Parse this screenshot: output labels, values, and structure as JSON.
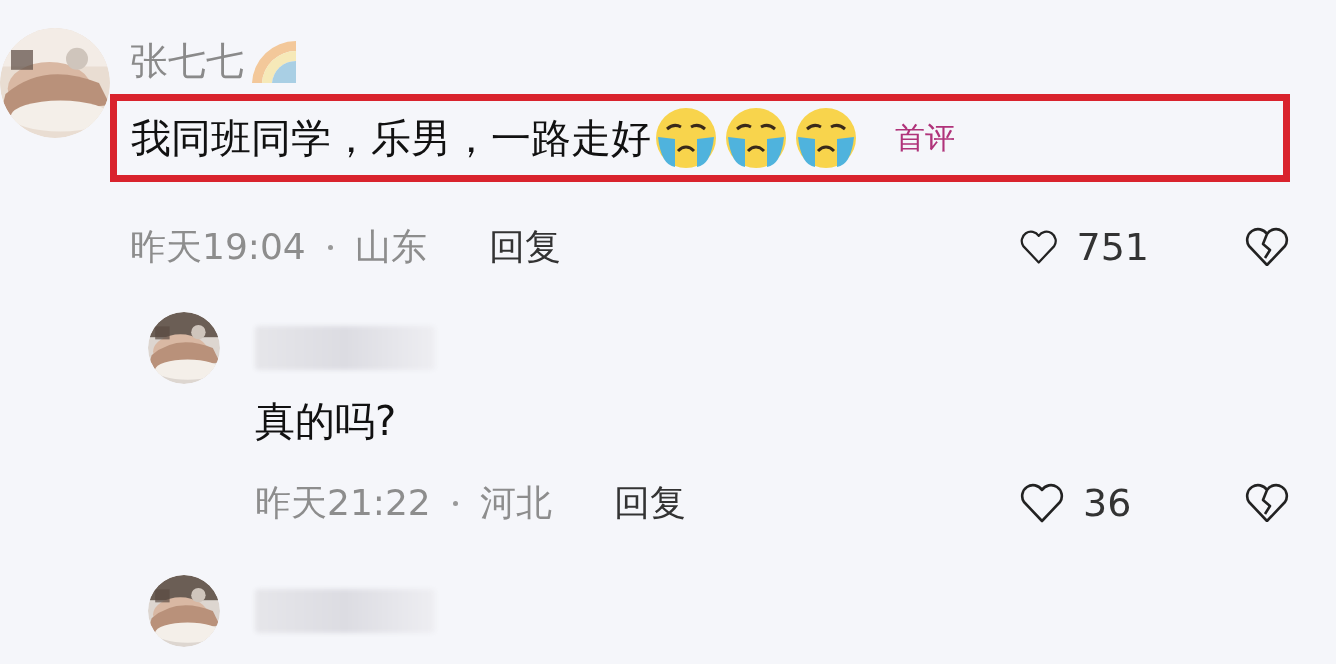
{
  "comments": [
    {
      "kind": "full",
      "author": "张七七",
      "author_badge": {
        "kind": "rainbow"
      },
      "author_hidden": false,
      "text": "我同班同学，乐男，一路走好",
      "highlighted": true,
      "reactions": [
        {
          "kind": "crying-face"
        },
        {
          "kind": "crying-face"
        },
        {
          "kind": "crying-face"
        }
      ],
      "badge": "首评",
      "time": "昨天19:04",
      "location": "山东",
      "reply_label": "回复",
      "likes": "751",
      "children": [
        {
          "kind": "full",
          "author_hidden": true,
          "text": "真的吗?",
          "highlighted": false,
          "time": "昨天21:22",
          "location": "河北",
          "reply_label": "回复",
          "likes": "36"
        },
        {
          "kind": "partial",
          "author_hidden": true
        }
      ]
    }
  ]
}
